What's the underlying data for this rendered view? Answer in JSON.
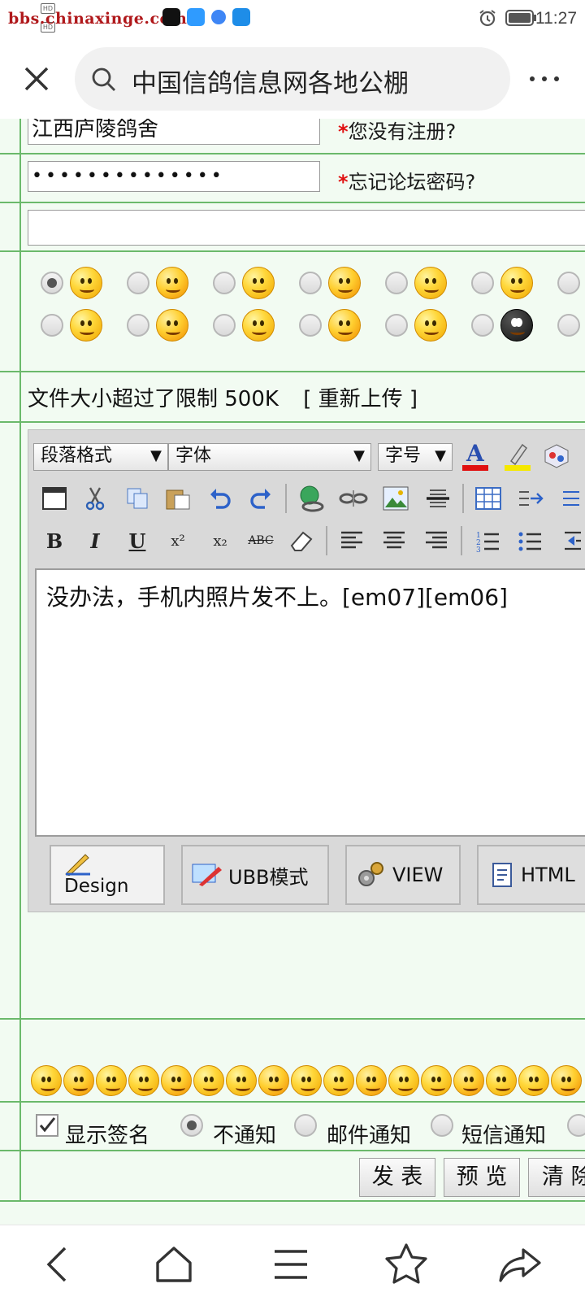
{
  "status_bar": {
    "watermark": "bbs.chinaxinge.com",
    "time": "11:27",
    "hd1": "HD",
    "hd2": "HD"
  },
  "browser": {
    "url_title": "中国信鸽信息网各地公棚",
    "close_icon": "close-icon",
    "search_icon": "search-icon",
    "more_icon": "more-icon"
  },
  "form": {
    "username": "江西庐陵鸽舍",
    "not_registered": "您没有注册?",
    "password_dots": "••••••••••••••",
    "forgot_password": "忘记论坛密码?",
    "required_mark": "*",
    "title_value": "",
    "file_size_notice": "文件大小超过了限制 500K",
    "reupload": "[ 重新上传 ]"
  },
  "editor": {
    "paragraph_select": "段落格式",
    "font_select": "字体",
    "size_select": "字号",
    "content": "没办法，手机内照片发不上。[em07][em06]",
    "modes": [
      {
        "label": "Design"
      },
      {
        "label": "UBB模式"
      },
      {
        "label": "VIEW"
      },
      {
        "label": "HTML"
      }
    ],
    "format": {
      "bold": "B",
      "italic": "I",
      "underline": "U",
      "superscript": "x²",
      "subscript": "x₂",
      "strike": "ABC"
    }
  },
  "options": {
    "show_signature": "显示签名",
    "no_notify": "不通知",
    "email_notify": "邮件通知",
    "sms_notify": "短信通知"
  },
  "buttons": {
    "submit": "发 表",
    "preview": "预 览",
    "clear": "清 除"
  },
  "colors": {
    "border_green": "#6bb96b",
    "bg_green": "#f2fbf2",
    "required_red": "#e01010"
  }
}
